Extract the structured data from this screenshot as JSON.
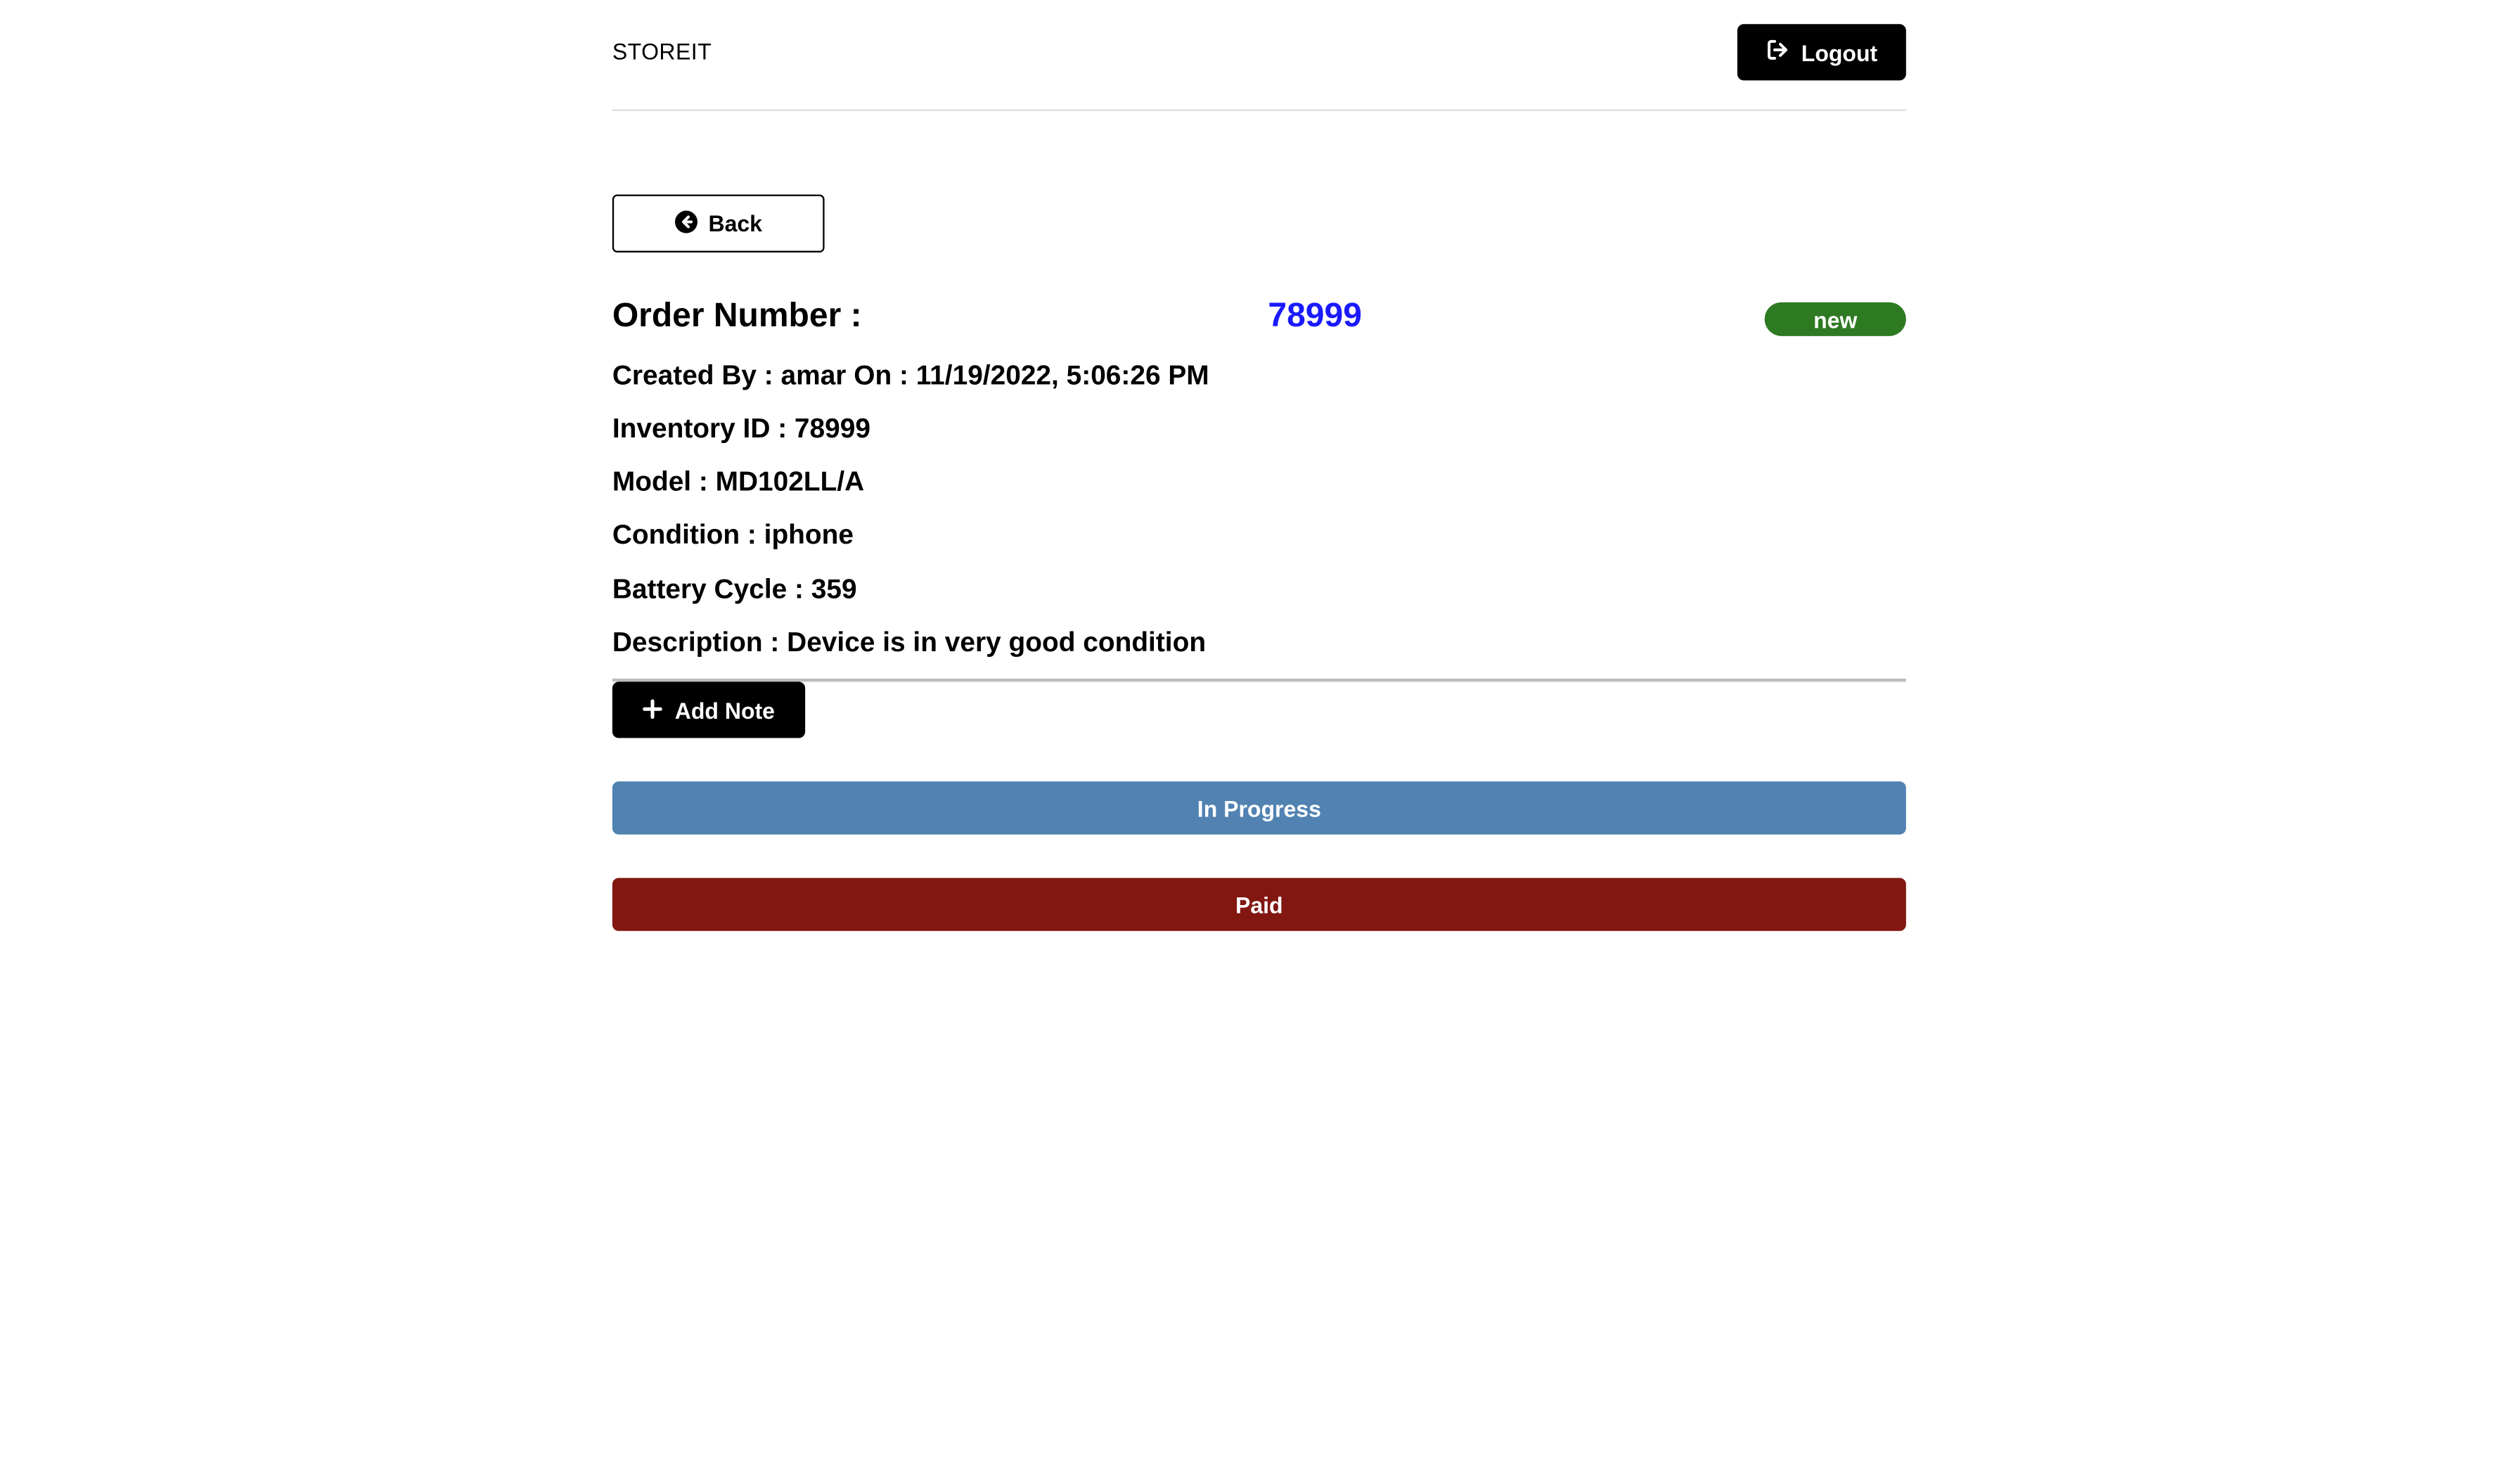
{
  "header": {
    "brand": "STOREIT",
    "logout_label": "Logout",
    "logout_icon": "sign-out-icon"
  },
  "back": {
    "label": "Back",
    "icon": "arrow-circle-left-icon"
  },
  "order": {
    "number_label": "Order Number :",
    "number_value": "78999",
    "status": "new",
    "status_color": "#2e7a22",
    "number_color": "#1a1aff"
  },
  "details": {
    "created_by": "Created By : amar On : 11/19/2022, 5:06:26 PM",
    "inventory_id": "Inventory ID : 78999",
    "model": "Model : MD102LL/A",
    "condition": "Condition : iphone",
    "battery_cycle": "Battery Cycle : 359",
    "description": "Description : Device is in very good condition"
  },
  "actions": {
    "add_note_label": "Add Note",
    "add_note_icon": "plus-icon",
    "in_progress_label": "In Progress",
    "in_progress_color": "#5182b2",
    "paid_label": "Paid",
    "paid_color": "#821712"
  }
}
